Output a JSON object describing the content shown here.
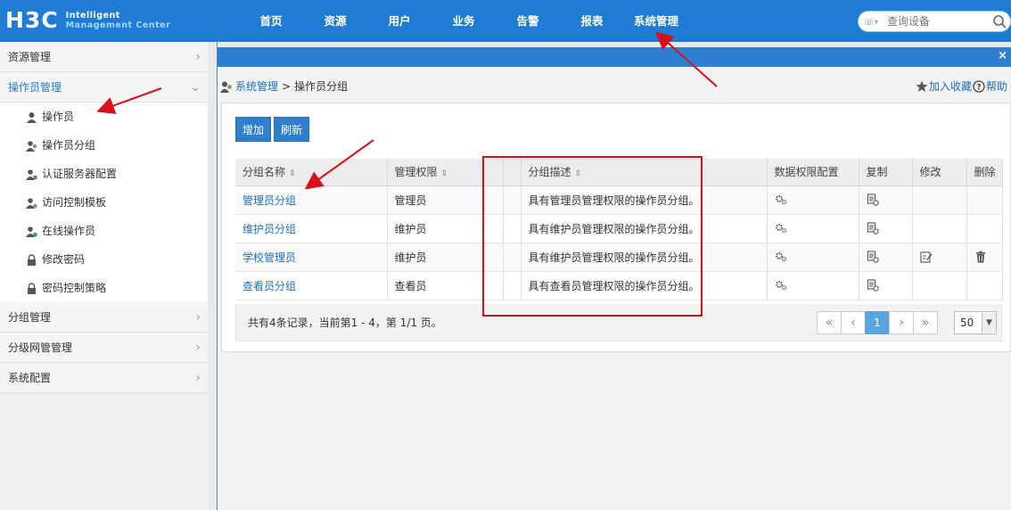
{
  "header": {
    "logo": "H3C",
    "logo_sub_line1": "Intelligent",
    "logo_sub_line2": "Management Center",
    "nav": [
      "首页",
      "资源",
      "用户",
      "业务",
      "告警",
      "报表",
      "系统管理"
    ],
    "search_placeholder": "查询设备"
  },
  "sidebar": {
    "groups": [
      {
        "label": "资源管理",
        "caret": "›"
      },
      {
        "label": "操作员管理",
        "caret": "⌄"
      }
    ],
    "items": [
      {
        "label": "操作员",
        "icon": "user-icon"
      },
      {
        "label": "操作员分组",
        "icon": "user-group-icon"
      },
      {
        "label": "认证服务器配置",
        "icon": "user-server-icon"
      },
      {
        "label": "访问控制模板",
        "icon": "user-access-icon"
      },
      {
        "label": "在线操作员",
        "icon": "user-online-icon"
      },
      {
        "label": "修改密码",
        "icon": "lock-icon"
      },
      {
        "label": "密码控制策略",
        "icon": "lock-icon"
      }
    ],
    "groups_after": [
      {
        "label": "分组管理",
        "caret": "›"
      },
      {
        "label": "分级网管管理",
        "caret": "›"
      },
      {
        "label": "系统配置",
        "caret": "›"
      }
    ]
  },
  "tabbar": {
    "close": "×"
  },
  "breadcrumb": {
    "root": "系统管理",
    "sep": ">",
    "current": "操作员分组"
  },
  "right_links": {
    "favorite": "加入收藏",
    "help": "帮助"
  },
  "buttons": {
    "add": "增加",
    "refresh": "刷新"
  },
  "table": {
    "columns": [
      "分组名称",
      "管理权限",
      "分组描述",
      "数据权限配置",
      "复制",
      "修改",
      "删除"
    ],
    "sort_glyph": "⇕",
    "rows": [
      {
        "name": "管理员分组",
        "role": "管理员",
        "desc": "具有管理员管理权限的操作员分组。",
        "editable": false,
        "deletable": false
      },
      {
        "name": "维护员分组",
        "role": "维护员",
        "desc": "具有维护员管理权限的操作员分组。",
        "editable": false,
        "deletable": false
      },
      {
        "name": "学校管理员",
        "role": "维护员",
        "desc": "具有维护员管理权限的操作员分组。",
        "editable": true,
        "deletable": true
      },
      {
        "name": "查看员分组",
        "role": "查看员",
        "desc": "具有查看员管理权限的操作员分组。",
        "editable": false,
        "deletable": false
      }
    ]
  },
  "footer": {
    "info": "共有4条记录，当前第1 - 4，第 1/1 页。",
    "pager": [
      "«",
      "‹",
      "1",
      "›",
      "»"
    ],
    "page_size": "50"
  },
  "colors": {
    "header": "#1f7bd3",
    "accent": "#2f7fcc",
    "annotation": "#d8101c"
  }
}
